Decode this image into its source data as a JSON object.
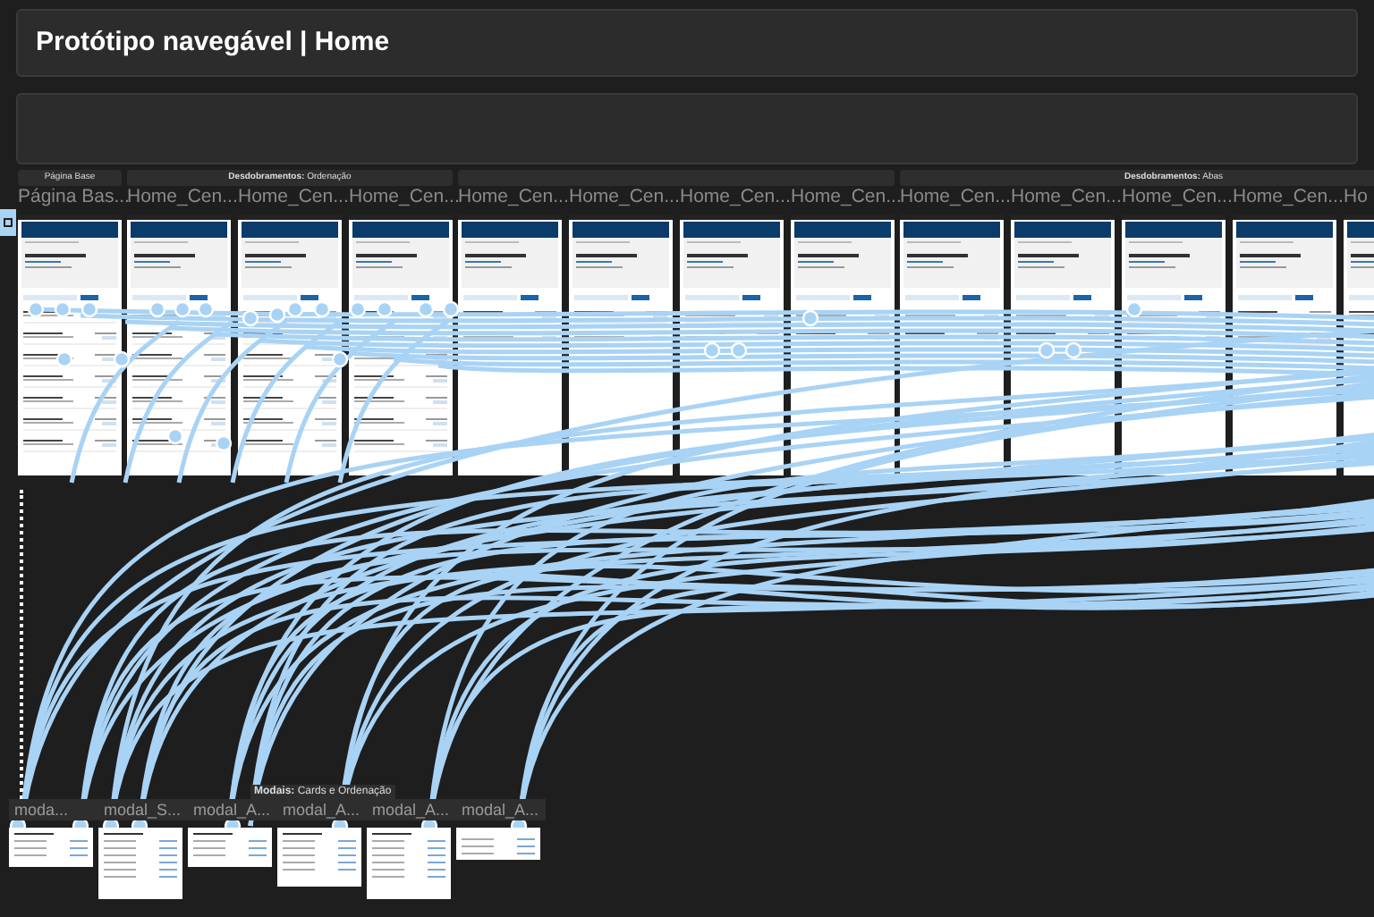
{
  "title": "Protótipo navegável | Home",
  "sections": [
    {
      "label": "Página Base",
      "frames": [
        {
          "name": "Página Bas...",
          "kind": "full"
        }
      ]
    },
    {
      "label": "**Desdobramentos:** Ordenação",
      "frames": [
        {
          "name": "Home_Cen...",
          "kind": "full"
        },
        {
          "name": "Home_Cen...",
          "kind": "full"
        },
        {
          "name": "Home_Cen...",
          "kind": "full"
        }
      ]
    },
    {
      "frames": [
        {
          "name": "Home_Cen...",
          "kind": "short"
        },
        {
          "name": "Home_Cen...",
          "kind": "short"
        },
        {
          "name": "Home_Cen...",
          "kind": "short"
        },
        {
          "name": "Home_Cen...",
          "kind": "short"
        }
      ]
    },
    {
      "label": "**Desdobramentos:** Abas",
      "frames": [
        {
          "name": "Home_Cen...",
          "kind": "short"
        },
        {
          "name": "Home_Cen...",
          "kind": "short"
        },
        {
          "name": "Home_Cen...",
          "kind": "short"
        },
        {
          "name": "Home_Cen...",
          "kind": "short"
        },
        {
          "name": "Ho",
          "kind": "short"
        }
      ]
    }
  ],
  "modals_label": "**Modais:** Cards e Ordenação",
  "modals": [
    {
      "name": "moda...",
      "kind": "small"
    },
    {
      "name": "modal_S...",
      "kind": "tall"
    },
    {
      "name": "modal_A...",
      "kind": "small"
    },
    {
      "name": "modal_A...",
      "kind": "medium"
    },
    {
      "name": "modal_A...",
      "kind": "tall"
    },
    {
      "name": "modal_A...",
      "kind": "tiny"
    }
  ]
}
